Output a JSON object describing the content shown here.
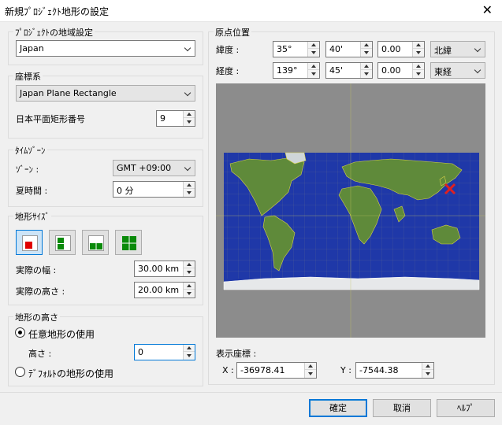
{
  "window": {
    "title": "新規ﾌﾟﾛｼﾞｪｸﾄ地形の設定",
    "close_icon": "close-icon"
  },
  "region": {
    "title": "ﾌﾟﾛｼﾞｪｸﾄの地域設定",
    "value": "Japan"
  },
  "coords": {
    "title": "座標系",
    "system": "Japan Plane Rectangle",
    "number_label": "日本平面矩形番号",
    "number": "9"
  },
  "timezone": {
    "title": "ﾀｲﾑｿﾞｰﾝ",
    "zone_label": "ｿﾞｰﾝ :",
    "zone": "GMT +09:00",
    "dst_label": "夏時間 :",
    "dst": "0 分"
  },
  "terrain_size": {
    "title": "地形ｻｲｽﾞ",
    "width_label": "実際の幅 :",
    "width": "30.00 km",
    "height_label": "実際の高さ :",
    "height": "20.00 km",
    "accent": "#0078d7"
  },
  "terrain_height": {
    "title": "地形の高さ",
    "custom_label": "任意地形の使用",
    "height_label": "高さ :",
    "height": "0",
    "default_label": "ﾃﾞﾌｫﾙﾄの地形の使用"
  },
  "origin": {
    "title": "原点位置",
    "lat_label": "緯度 :",
    "lat_deg": "35°",
    "lat_min": "40'",
    "lat_sec": "0.00",
    "lat_hemi": "北緯",
    "lon_label": "経度 :",
    "lon_deg": "139°",
    "lon_min": "45'",
    "lon_sec": "0.00",
    "lon_hemi": "東経",
    "marker_color": "#e02020"
  },
  "display": {
    "title": "表示座標 :",
    "x_label": "X :",
    "x": "-36978.41",
    "y_label": "Y :",
    "y": "-7544.38"
  },
  "buttons": {
    "ok": "確定",
    "cancel": "取消",
    "help": "ﾍﾙﾌﾟ"
  }
}
